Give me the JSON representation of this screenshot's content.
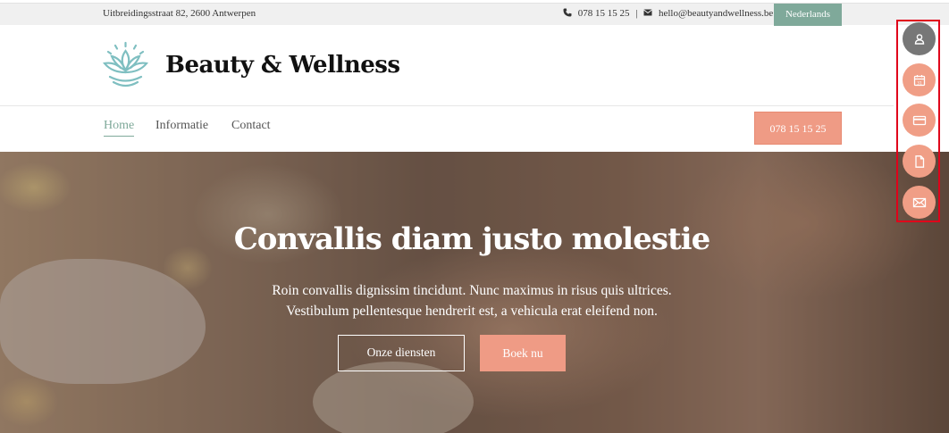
{
  "topbar": {
    "address": "Uitbreidingsstraat 82, 2600 Antwerpen",
    "phone": "078 15 15 25",
    "separator": "|",
    "email": "hello@beautyandwellness.be",
    "language": "Nederlands"
  },
  "header": {
    "brand": "Beauty & Wellness",
    "logo_icon": "lotus-icon"
  },
  "nav": {
    "items": [
      {
        "label": "Home",
        "active": true
      },
      {
        "label": "Informatie",
        "active": false
      },
      {
        "label": "Contact",
        "active": false
      }
    ],
    "phone_button": "078 15 15 25"
  },
  "hero": {
    "title": "Convallis diam justo molestie",
    "line1": "Roin convallis dignissim tincidunt. Nunc maximus in risus quis ultrices.",
    "line2": "Vestibulum pellentesque hendrerit est, a vehicula erat eleifend non.",
    "btn_services": "Onze diensten",
    "btn_book": "Boek nu"
  },
  "float_actions": [
    {
      "icon": "user-icon"
    },
    {
      "icon": "calendar-icon"
    },
    {
      "icon": "credit-card-icon"
    },
    {
      "icon": "document-icon"
    },
    {
      "icon": "mail-icon"
    }
  ],
  "colors": {
    "accent_green": "#7fa99a",
    "accent_salmon": "#ef9b85",
    "highlight_border": "#e0001a"
  }
}
